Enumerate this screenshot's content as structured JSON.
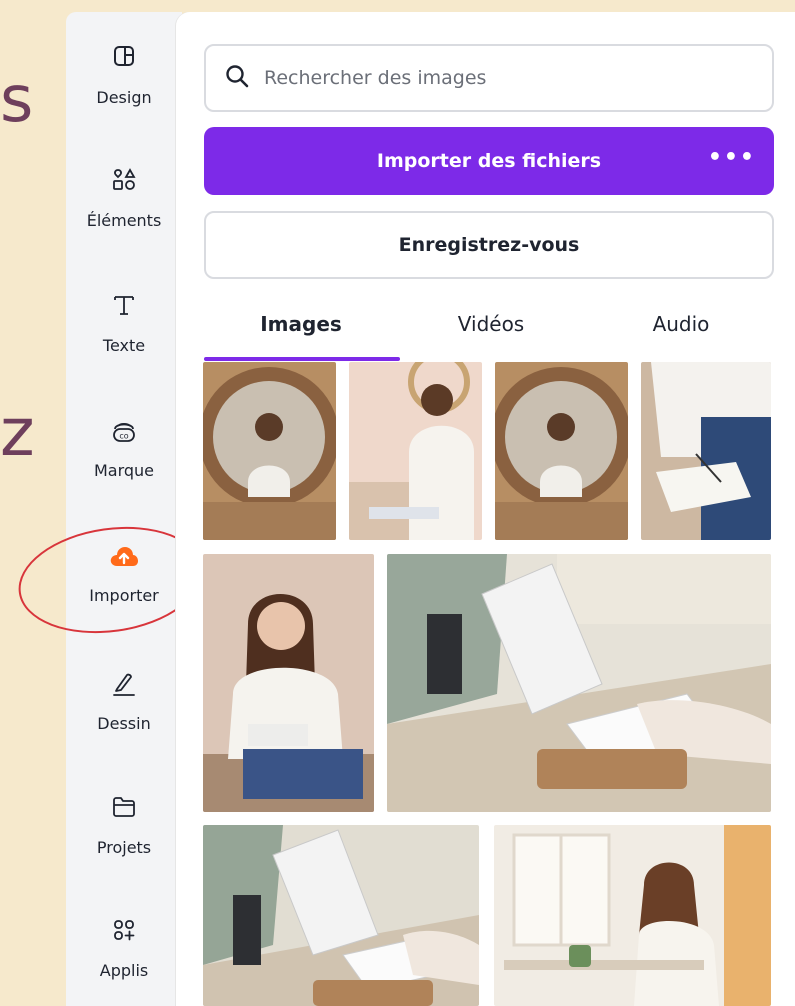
{
  "sidebar": {
    "items": [
      {
        "label": "Design",
        "icon": "layout-icon"
      },
      {
        "label": "Éléments",
        "icon": "shapes-icon"
      },
      {
        "label": "Texte",
        "icon": "text-icon"
      },
      {
        "label": "Marque",
        "icon": "brand-icon"
      },
      {
        "label": "Importer",
        "icon": "upload-cloud-icon"
      },
      {
        "label": "Dessin",
        "icon": "pen-icon"
      },
      {
        "label": "Projets",
        "icon": "folder-icon"
      },
      {
        "label": "Applis",
        "icon": "apps-icon"
      }
    ]
  },
  "search": {
    "placeholder": "Rechercher des images",
    "value": ""
  },
  "buttons": {
    "upload_label": "Importer des fichiers",
    "more_label": "•••",
    "register_label": "Enregistrez-vous"
  },
  "tabs": [
    {
      "label": "Images",
      "active": true
    },
    {
      "label": "Vidéos",
      "active": false
    },
    {
      "label": "Audio",
      "active": false
    }
  ],
  "colors": {
    "accent": "#7d2ae8",
    "background": "#f6e9cc",
    "annotation": "#d8353b",
    "upload_icon": "#ff6a1a"
  },
  "gallery": {
    "images": [
      "woman-in-round-mirror",
      "woman-writing-smiling",
      "woman-in-round-mirror",
      "writing-in-notebook",
      "woman-with-glasses-writing",
      "laptop-on-desk",
      "typing-on-laptop",
      "woman-at-desk-window"
    ]
  }
}
